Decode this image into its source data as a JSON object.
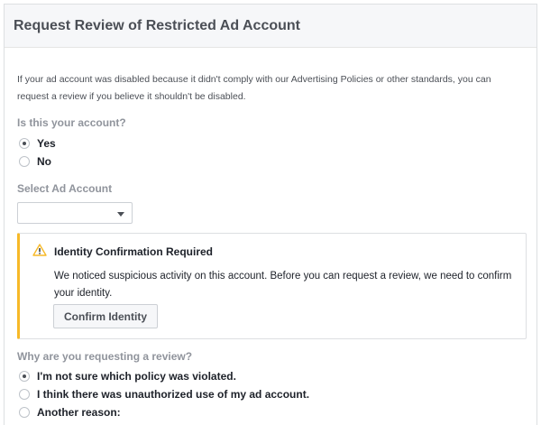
{
  "header": {
    "title": "Request Review of Restricted Ad Account"
  },
  "intro": "If your ad account was disabled because it didn't comply with our Advertising Policies or other standards, you can request a review if you believe it shouldn't be disabled.",
  "question_account": {
    "label": "Is this your account?",
    "options": [
      {
        "label": "Yes",
        "selected": true
      },
      {
        "label": "No",
        "selected": false
      }
    ]
  },
  "select_account": {
    "label": "Select Ad Account",
    "value": ""
  },
  "identity_alert": {
    "icon": "warning-icon",
    "title": "Identity Confirmation Required",
    "text": "We noticed suspicious activity on this account. Before you can request a review, we need to confirm your identity.",
    "button_label": "Confirm Identity",
    "accent_color": "#f7b928"
  },
  "question_reason": {
    "label": "Why are you requesting a review?",
    "options": [
      {
        "label": "I'm not sure which policy was violated.",
        "selected": true
      },
      {
        "label": "I think there was unauthorized use of my ad account.",
        "selected": false
      },
      {
        "label": "Another reason:",
        "selected": false
      }
    ]
  }
}
